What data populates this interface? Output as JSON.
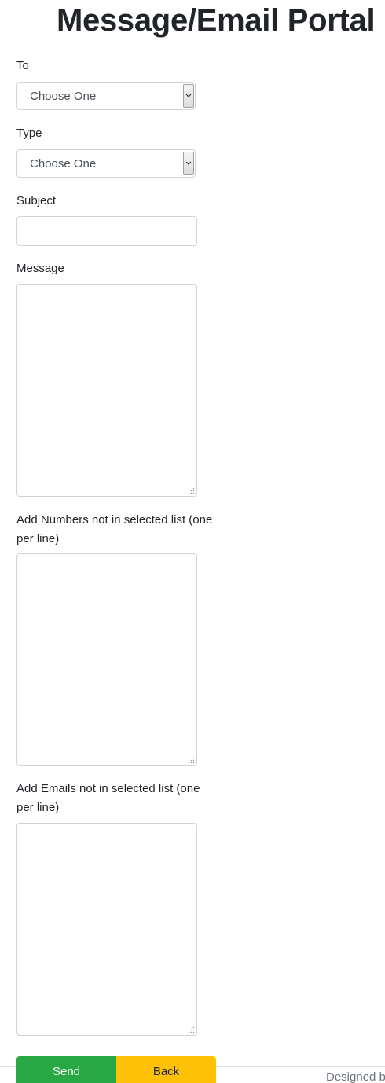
{
  "header": {
    "title": "Message/Email Portal"
  },
  "form": {
    "to": {
      "label": "To",
      "selected": "Choose One"
    },
    "type": {
      "label": "Type",
      "selected": "Choose One"
    },
    "subject": {
      "label": "Subject",
      "value": ""
    },
    "message": {
      "label": "Message",
      "value": ""
    },
    "numbers": {
      "label": "Add Numbers not in selected list (one per line)",
      "value": ""
    },
    "emails": {
      "label": "Add Emails not in selected list (one per line)",
      "value": ""
    }
  },
  "buttons": {
    "send_label": "Send",
    "back_label": "Back",
    "send_color": "#28a745",
    "back_color": "#ffc107"
  },
  "footer": {
    "text": "Designed b"
  },
  "icons": {
    "select_arrow": "chevron-down-icon",
    "textarea_grip": "resize-grip-icon"
  }
}
